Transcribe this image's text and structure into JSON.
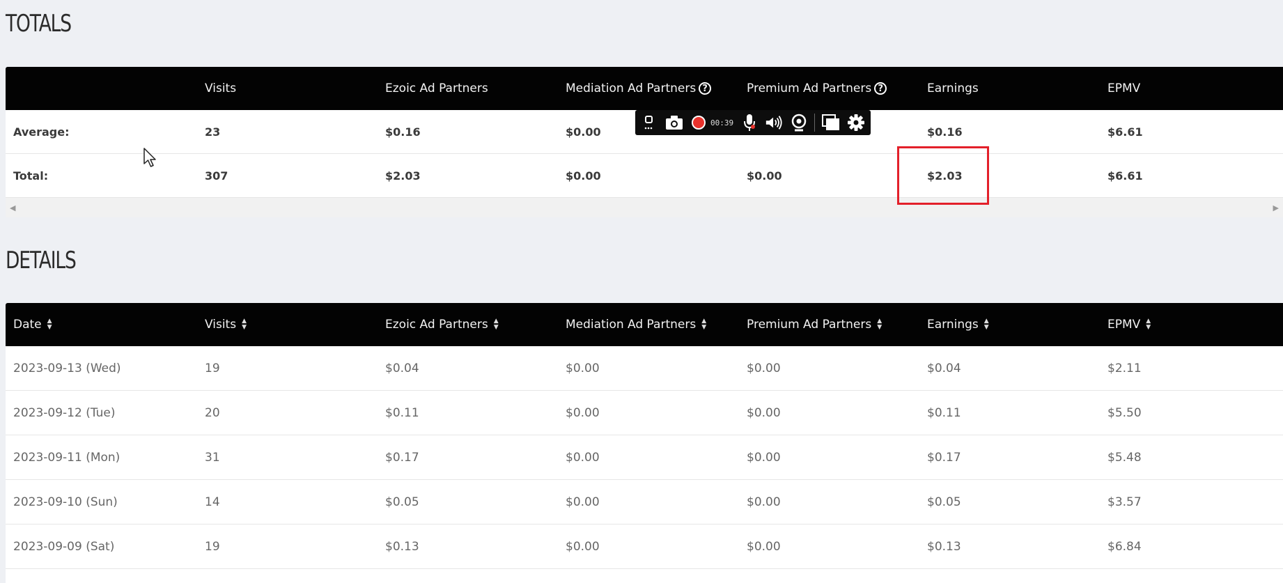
{
  "totals": {
    "title": "TOTALS",
    "headers": [
      "",
      "Visits",
      "Ezoic Ad Partners",
      "Mediation Ad Partners",
      "Premium Ad Partners",
      "Earnings",
      "EPMV"
    ],
    "help_icon_glyph": "?",
    "rows": [
      {
        "cells": [
          "Average:",
          "23",
          "$0.16",
          "$0.00",
          "",
          "$0.16",
          "$6.61"
        ]
      },
      {
        "cells": [
          "Total:",
          "307",
          "$2.03",
          "$0.00",
          "$0.00",
          "$2.03",
          "$6.61"
        ]
      }
    ],
    "scroll_left_glyph": "◀",
    "scroll_right_glyph": "▶"
  },
  "details": {
    "title": "DETAILS",
    "headers": [
      "Date",
      "Visits",
      "Ezoic Ad Partners",
      "Mediation Ad Partners",
      "Premium Ad Partners",
      "Earnings",
      "EPMV"
    ],
    "sort_up_glyph": "▲",
    "sort_down_glyph": "▼",
    "rows": [
      {
        "cells": [
          "2023-09-13 (Wed)",
          "19",
          "$0.04",
          "$0.00",
          "$0.00",
          "$0.04",
          "$2.11"
        ]
      },
      {
        "cells": [
          "2023-09-12 (Tue)",
          "20",
          "$0.11",
          "$0.00",
          "$0.00",
          "$0.11",
          "$5.50"
        ]
      },
      {
        "cells": [
          "2023-09-11 (Mon)",
          "31",
          "$0.17",
          "$0.00",
          "$0.00",
          "$0.17",
          "$5.48"
        ]
      },
      {
        "cells": [
          "2023-09-10 (Sun)",
          "14",
          "$0.05",
          "$0.00",
          "$0.00",
          "$0.05",
          "$3.57"
        ]
      },
      {
        "cells": [
          "2023-09-09 (Sat)",
          "19",
          "$0.13",
          "$0.00",
          "$0.00",
          "$0.13",
          "$6.84"
        ]
      }
    ]
  },
  "recorder_toolbar": {
    "time": "00:39",
    "icons": [
      "pin-icon",
      "camera-icon",
      "record-icon",
      "microphone-icon",
      "speaker-icon",
      "webcam-icon",
      "window-icon",
      "gear-icon"
    ]
  },
  "colors": {
    "header_bg": "#030303",
    "highlight": "#e3202a",
    "record": "#e8322c",
    "page_bg": "#eef0f4"
  }
}
